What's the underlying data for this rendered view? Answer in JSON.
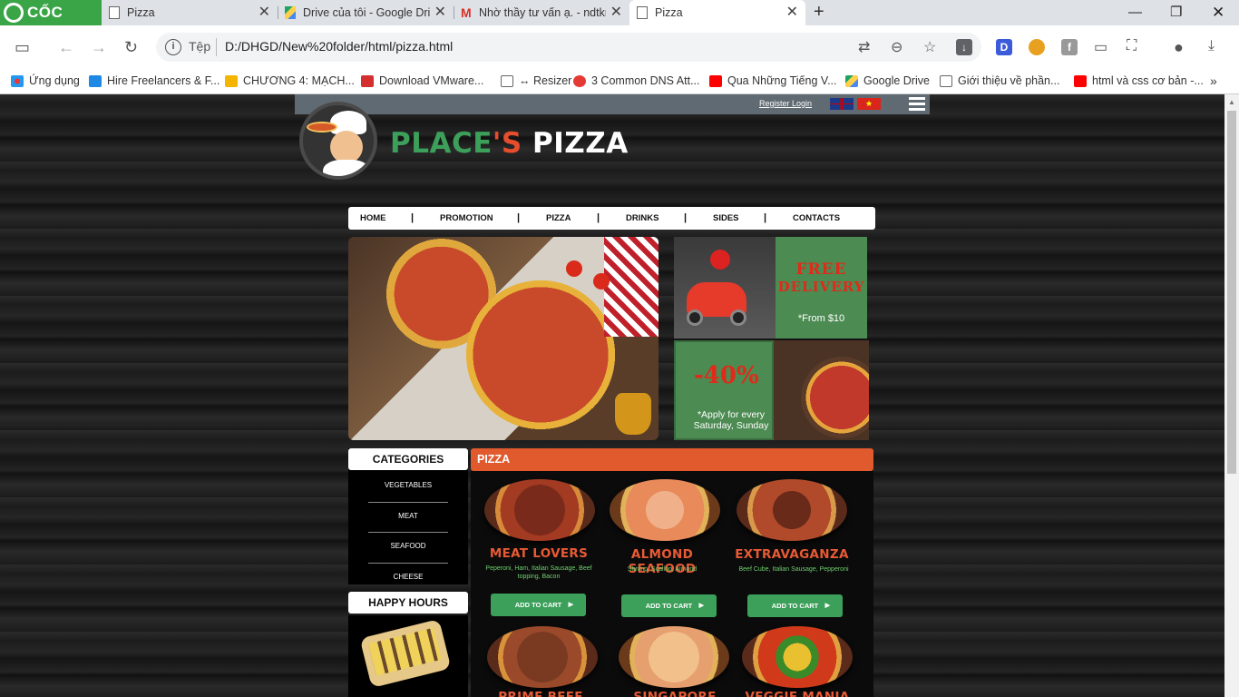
{
  "browser": {
    "logo_text": "CỐC CỐC",
    "tabs": [
      {
        "title": "Pizza"
      },
      {
        "title": "Drive của tôi - Google Dri"
      },
      {
        "title": "Nhờ thầy tư vấn ạ. - ndtkn"
      },
      {
        "title": "Pizza"
      }
    ],
    "address_label": "Tệp",
    "url": "D:/DHGD/New%20folder/html/pizza.html",
    "bookmarks": [
      {
        "label": "Ứng dụng"
      },
      {
        "label": "Hire Freelancers & F..."
      },
      {
        "label": "CHƯƠNG 4: MẠCH..."
      },
      {
        "label": "Download VMware..."
      },
      {
        "label": "↔ Resizer"
      },
      {
        "label": "3 Common DNS Att..."
      },
      {
        "label": "Qua Những Tiếng V..."
      },
      {
        "label": "Google Drive"
      },
      {
        "label": "Giới thiệu về phần..."
      },
      {
        "label": "html và css cơ bản -..."
      }
    ],
    "ext_d": "D"
  },
  "page": {
    "register_login": "Register Login",
    "brand": {
      "part1": "PLACE",
      "part2": "'S ",
      "part3": "PIZZA"
    },
    "nav": [
      "HOME",
      "PROMOTION",
      "PIZZA",
      "DRINKS",
      "SIDES",
      "CONTACTS"
    ],
    "nav_sep": "|",
    "promo_delivery": {
      "line1": "FREE",
      "line2": "DELIVERY",
      "note": "*From $10"
    },
    "promo_discount": {
      "percent": "-40%",
      "note": "*Apply for every Saturday, Sunday"
    },
    "categories": {
      "title": "CATEGORIES",
      "items": [
        "VEGETABLES",
        "MEAT",
        "SEAFOOD",
        "CHEESE"
      ]
    },
    "happy_hours": "HAPPY HOURS",
    "section_title": "PIZZA",
    "products": [
      {
        "name": "MEAT LOVERS",
        "desc": "Peperoni, Ham, Italian Sausage, Beef topping, Bacon",
        "cart": "ADD TO CART"
      },
      {
        "name": "ALMOND SEAFOOD",
        "desc": "Shrimp, Scallop, Almond",
        "cart": "ADD TO CART"
      },
      {
        "name": "EXTRAVAGANZA",
        "desc": "Beef Cube, Italian Sausage, Pepperoni",
        "cart": "ADD TO CART"
      },
      {
        "name": "PRIME BEEF",
        "desc": "",
        "cart": ""
      },
      {
        "name": "SINGAPORE SEAFOOD",
        "desc": "",
        "cart": ""
      },
      {
        "name": "VEGGIE MANIA",
        "desc": "",
        "cart": ""
      }
    ]
  },
  "colors": {
    "brand_green": "#3ca05a",
    "brand_orange": "#e05a2e",
    "chrome_tabbar": "#dee1e6"
  }
}
